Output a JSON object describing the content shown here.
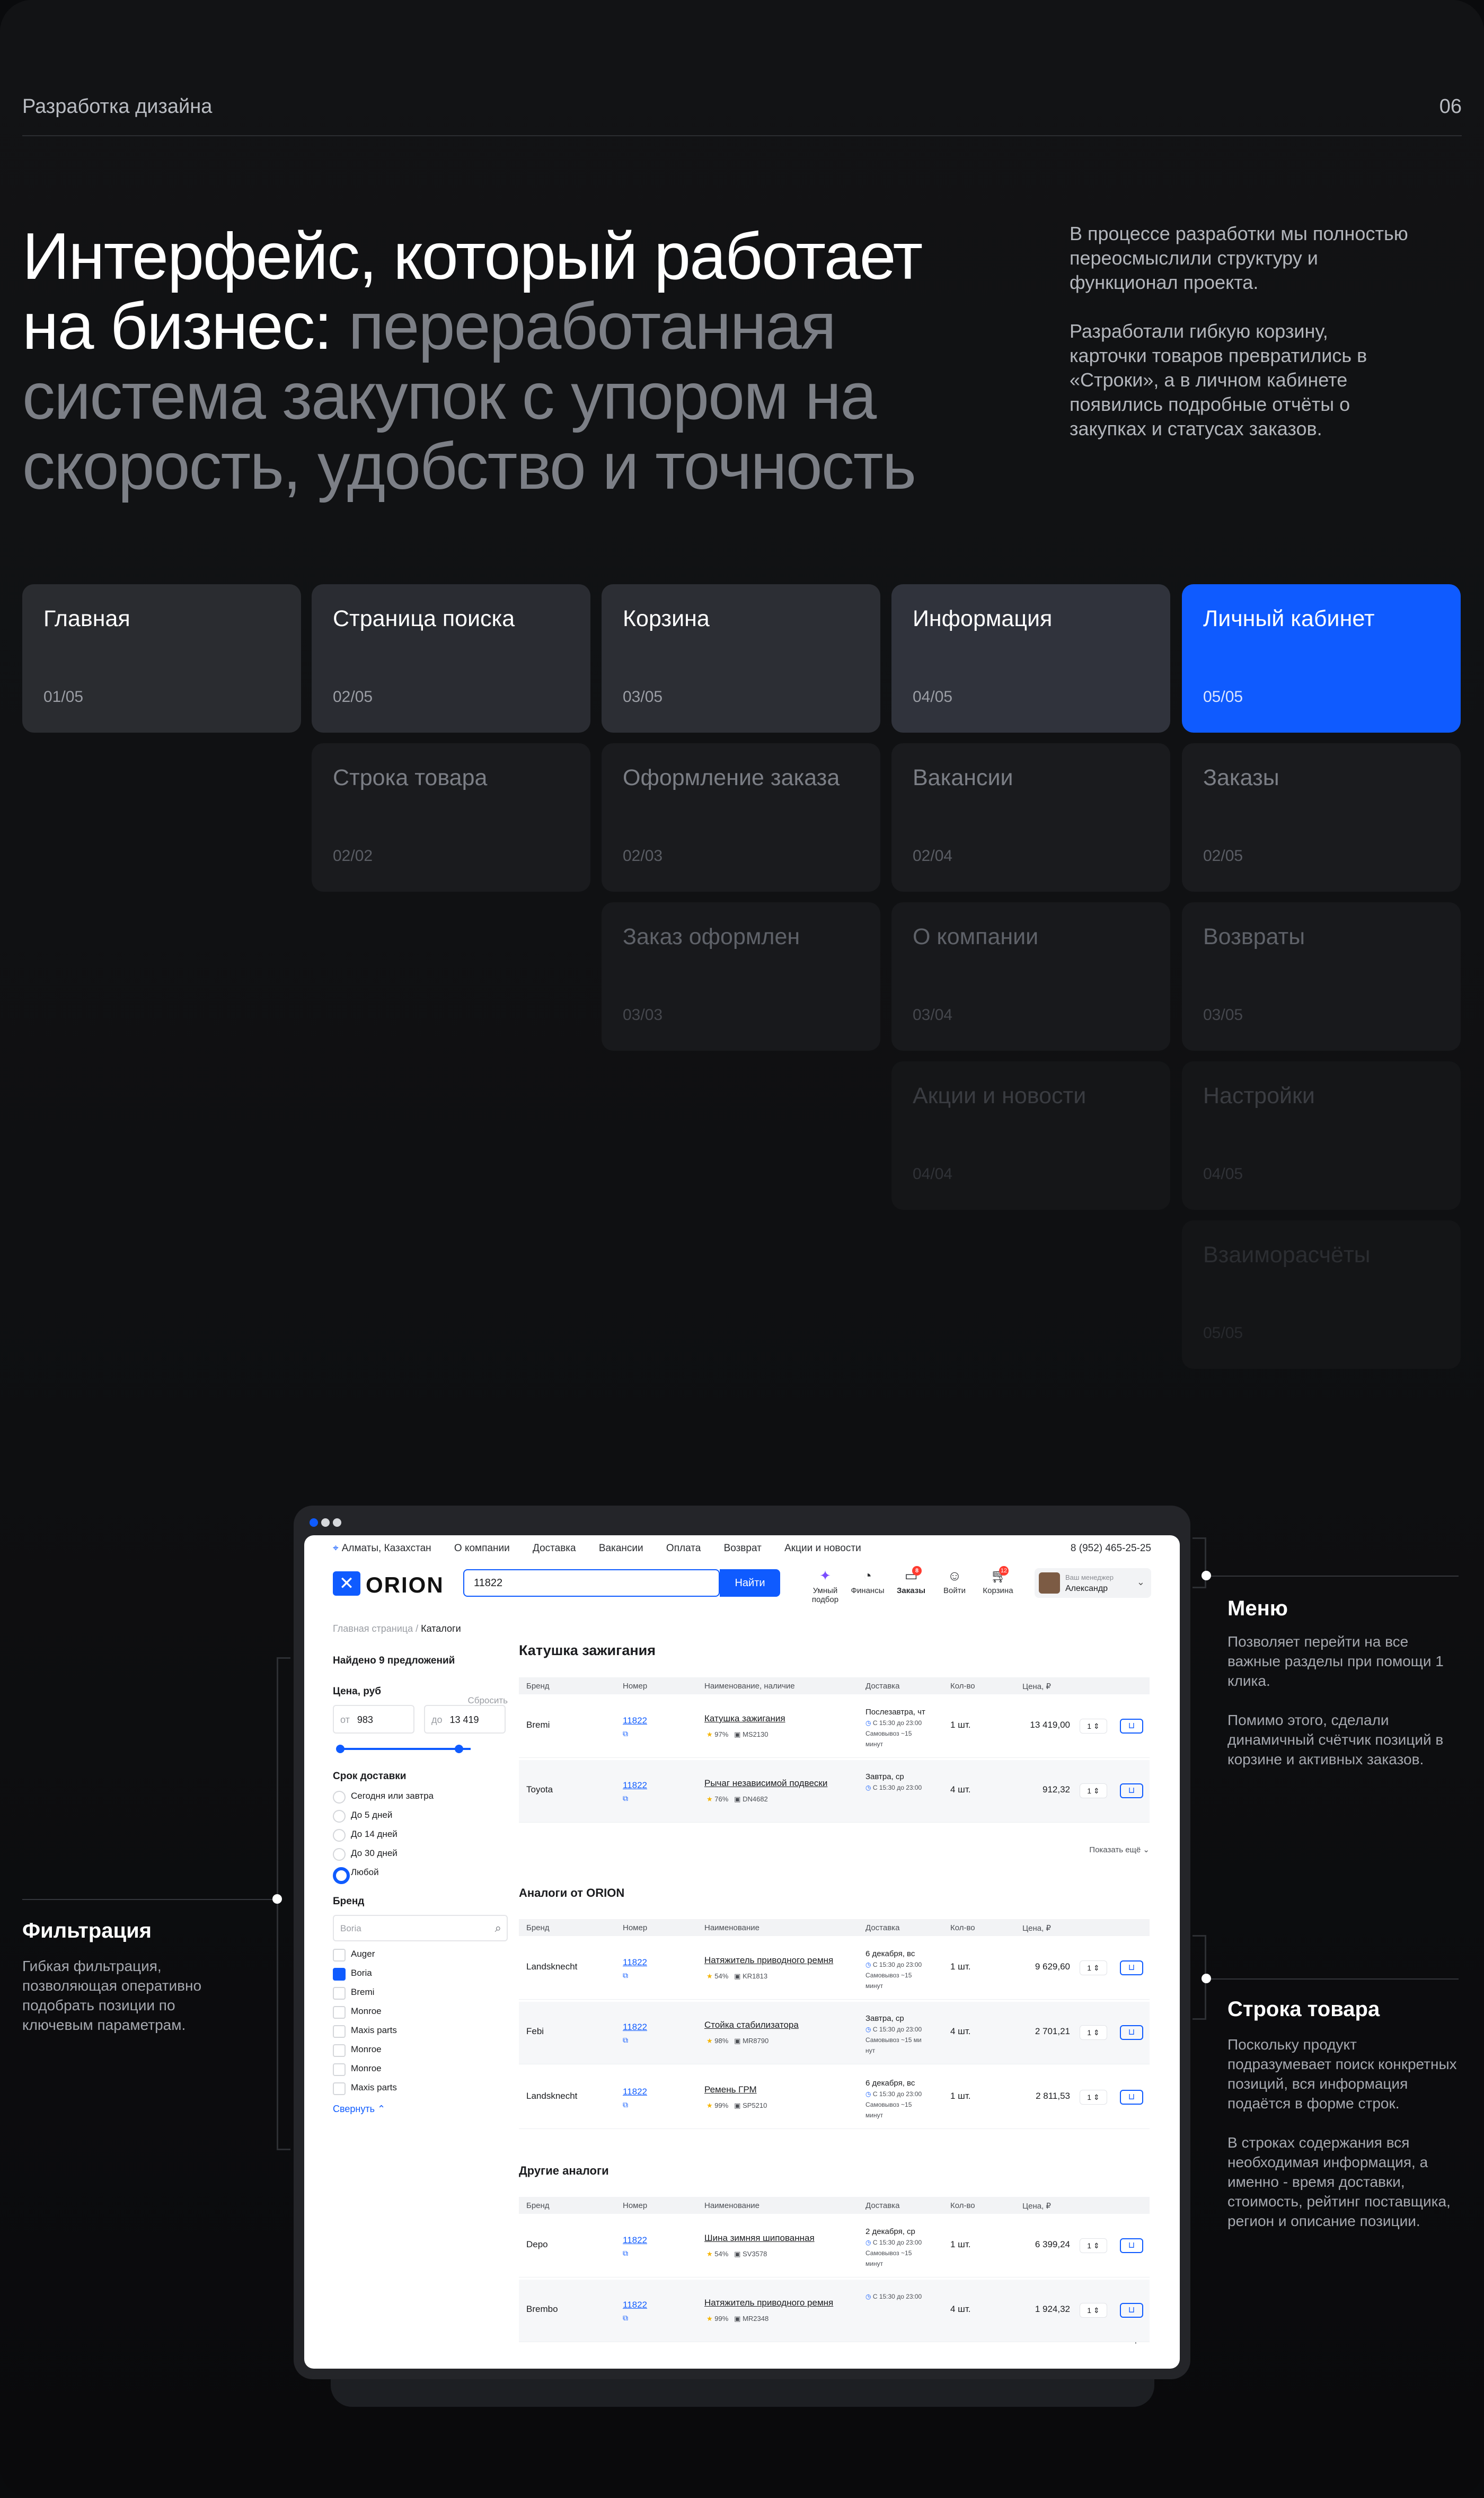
{
  "header": {
    "label": "Разработка дизайна",
    "page_number": "06"
  },
  "headline": {
    "white": "Интерфейс, который работает на бизнес:",
    "gray": "переработанная система закупок с упором на скорость, удобство и точность"
  },
  "intro": [
    "В процессе разработки мы полностью переосмыслили структуру и функционал проекта.",
    "Разработали гибкую корзину, карточки товаров превратились в «Строки», а в личном кабинете появились подробные отчёты о закупках и статусах заказов."
  ],
  "tiles": [
    {
      "title": "Главная",
      "num": "01/05"
    },
    {
      "title": "Страница поиска",
      "num": "02/05"
    },
    {
      "title": "Строка товара",
      "num": "02/02"
    },
    {
      "title": "Корзина",
      "num": "03/05"
    },
    {
      "title": "Оформление заказа",
      "num": "02/03"
    },
    {
      "title": "Заказ оформлен",
      "num": "03/03"
    },
    {
      "title": "Информация",
      "num": "04/05"
    },
    {
      "title": "Вакансии",
      "num": "02/04"
    },
    {
      "title": "О компании",
      "num": "03/04"
    },
    {
      "title": "Акции и новости",
      "num": "04/04"
    },
    {
      "title": "Личный кабинет",
      "num": "05/05"
    },
    {
      "title": "Заказы",
      "num": "02/05"
    },
    {
      "title": "Возвраты",
      "num": "03/05"
    },
    {
      "title": "Настройки",
      "num": "04/05"
    },
    {
      "title": "Взаиморасчёты",
      "num": "05/05"
    }
  ],
  "annotations": {
    "menu": {
      "title": "Меню",
      "text": [
        "Позволяет перейти на все важные разделы при помощи 1 клика.",
        "Помимо этого, сделали динамичный счётчик позиций в корзине и активных заказов."
      ]
    },
    "filter": {
      "title": "Фильтрация",
      "text": [
        "Гибкая фильтрация, позволяющая оперативно подобрать позиции по ключевым параметрам."
      ]
    },
    "row": {
      "title": "Строка товара",
      "text": [
        "Поскольку продукт подразумевает поиск конкретных позиций, вся информация подаётся в форме строк.",
        "В строках содержания вся необходимая информация, а именно - время доставки, стоимость, рейтинг поставщика, регион и описание позиции."
      ]
    }
  },
  "site": {
    "location": "Алматы, Казахстан",
    "topnav": [
      "О компании",
      "Доставка",
      "Вакансии",
      "Оплата",
      "Возврат",
      "Акции и новости"
    ],
    "phone": "8 (952) 465-25-25",
    "logo": "ORION",
    "search_value": "11822",
    "search_button": "Найти",
    "nav": [
      {
        "label": "Умный подбор",
        "icon": "sparkle-icon"
      },
      {
        "label": "Финансы",
        "icon": "chart-icon"
      },
      {
        "label": "Заказы",
        "icon": "orders-icon",
        "badge": "8"
      },
      {
        "label": "Войти",
        "icon": "user-icon"
      },
      {
        "label": "Корзина",
        "icon": "cart-icon",
        "badge": "12"
      }
    ],
    "user": {
      "role": "Ваш менеджер",
      "name": "Александр"
    },
    "breadcrumb": [
      "Главная страница",
      "/",
      "Каталоги"
    ]
  },
  "filters": {
    "found": "Найдено 9 предложений",
    "price_label": "Цена, руб",
    "reset": "Сбросить",
    "from_label": "от",
    "from": "983",
    "to_label": "до",
    "to": "13 419",
    "delivery_label": "Срок доставки",
    "delivery": [
      "Сегодня или завтра",
      "До 5 дней",
      "До 14 дней",
      "До 30 дней",
      "Любой"
    ],
    "brand_label": "Бренд",
    "brand_placeholder": "Boria",
    "brands": [
      "Auger",
      "Boria",
      "Bremi",
      "Monroe",
      "Maxis parts",
      "Monroe",
      "Monroe",
      "Maxis parts"
    ],
    "collapse": "Свернуть"
  },
  "results": {
    "title": "Катушка зажигания",
    "analogs_title": "Аналоги от ORION",
    "others_title": "Другие аналоги",
    "cols": [
      "Бренд",
      "Номер",
      "Наименование, наличие",
      "Доставка",
      "Кол-во",
      "Цена, ₽"
    ],
    "cols2": [
      "Бренд",
      "Номер",
      "Наименование",
      "Доставка",
      "Кол-во",
      "Цена, ₽"
    ],
    "show_more": "Показать ещё",
    "main_rows": [
      {
        "brand": "Bremi",
        "num": "11822",
        "name": "Катушка зажигания",
        "rating": "97%",
        "code": "MS2130",
        "del1": "Послезавтра, чт",
        "del2": "С 15:30 до 23:00",
        "del3": "Самовывоз ~15 минут",
        "qty": "1 шт.",
        "price": "13 419,00",
        "q": "1"
      },
      {
        "brand": "Toyota",
        "num": "11822",
        "name": "Рычаг независимой подвески",
        "rating": "76%",
        "code": "DN4682",
        "del1": "Завтра, ср",
        "del2": "С 15:30 до 23:00",
        "del3": "",
        "qty": "4 шт.",
        "price": "912,32",
        "q": "1"
      }
    ],
    "analog_rows": [
      {
        "brand": "Landsknecht",
        "num": "11822",
        "name": "Натяжитель приводного ремня",
        "rating": "54%",
        "code": "KR1813",
        "del1": "6 декабря, вс",
        "del2": "С 15:30 до 23:00",
        "del3": "Самовывоз ~15 минут",
        "qty": "1 шт.",
        "price": "9 629,60",
        "q": "1"
      },
      {
        "brand": "Febi",
        "num": "11822",
        "name": "Стойка стабилизатора",
        "rating": "98%",
        "code": "MR8790",
        "del1": "Завтра, ср",
        "del2": "С 15:30 до 23:00",
        "del3": "Самовывоз ~15 ми нут",
        "qty": "4 шт.",
        "price": "2 701,21",
        "q": "1"
      },
      {
        "brand": "Landsknecht",
        "num": "11822",
        "name": "Ремень ГРМ",
        "rating": "99%",
        "code": "SP5210",
        "del1": "6 декабря, вс",
        "del2": "С 15:30 до 23:00",
        "del3": "Самовывоз ~15 минут",
        "qty": "1 шт.",
        "price": "2 811,53",
        "q": "1"
      }
    ],
    "other_rows": [
      {
        "brand": "Depo",
        "num": "11822",
        "name": "Шина зимняя шипованная",
        "rating": "54%",
        "code": "SV3578",
        "del1": "2 декабря, ср",
        "del2": "С 15:30 до 23:00",
        "del3": "Самовывоз ~15 минут",
        "qty": "1 шт.",
        "price": "6 399,24",
        "q": "1"
      },
      {
        "brand": "Brembo",
        "num": "11822",
        "name": "Натяжитель приводного ремня",
        "rating": "99%",
        "code": "MR2348",
        "del1": "",
        "del2": "С 15:30 до 23:00",
        "del3": "",
        "qty": "4 шт.",
        "price": "1 924,32",
        "q": "1"
      }
    ]
  }
}
